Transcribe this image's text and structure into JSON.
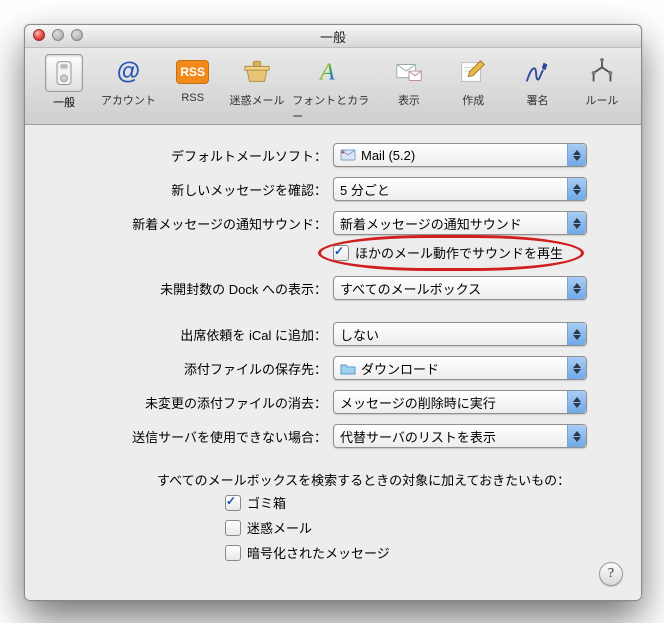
{
  "titlebar": {
    "title": "一般"
  },
  "toolbar": {
    "items": [
      {
        "label": "一般",
        "name": "toolbar-general",
        "iconColor": "#888"
      },
      {
        "label": "アカウント",
        "name": "toolbar-accounts"
      },
      {
        "label": "RSS",
        "name": "toolbar-rss"
      },
      {
        "label": "迷惑メール",
        "name": "toolbar-junk"
      },
      {
        "label": "フォントとカラー",
        "name": "toolbar-fonts-colors"
      },
      {
        "label": "表示",
        "name": "toolbar-viewing"
      },
      {
        "label": "作成",
        "name": "toolbar-composing"
      },
      {
        "label": "署名",
        "name": "toolbar-signatures"
      },
      {
        "label": "ルール",
        "name": "toolbar-rules"
      }
    ],
    "rss_badge": "RSS"
  },
  "rows": {
    "default_mail": {
      "label": "デフォルトメールソフト：",
      "value": "Mail (5.2)"
    },
    "check_new": {
      "label": "新しいメッセージを確認：",
      "value": "5 分ごと"
    },
    "sound": {
      "label": "新着メッセージの通知サウンド：",
      "value": "新着メッセージの通知サウンド"
    },
    "play_other_sounds": {
      "label": "ほかのメール動作でサウンドを再生",
      "checked": true
    },
    "dock_unread": {
      "label": "未開封数の Dock への表示：",
      "value": "すべてのメールボックス"
    },
    "ical_invites": {
      "label": "出席依頼を iCal に追加：",
      "value": "しない"
    },
    "downloads": {
      "label": "添付ファイルの保存先：",
      "value": "ダウンロード"
    },
    "remove_unedited": {
      "label": "未変更の添付ファイルの消去：",
      "value": "メッセージの削除時に実行"
    },
    "outgoing_unavail": {
      "label": "送信サーバを使用できない場合：",
      "value": "代替サーバのリストを表示"
    }
  },
  "search_section": {
    "heading": "すべてのメールボックスを検索するときの対象に加えておきたいもの：",
    "items": [
      {
        "label": "ゴミ箱",
        "checked": true,
        "name": "search-include-trash"
      },
      {
        "label": "迷惑メール",
        "checked": false,
        "name": "search-include-junk"
      },
      {
        "label": "暗号化されたメッセージ",
        "checked": false,
        "name": "search-include-encrypted"
      }
    ]
  },
  "help": "?"
}
